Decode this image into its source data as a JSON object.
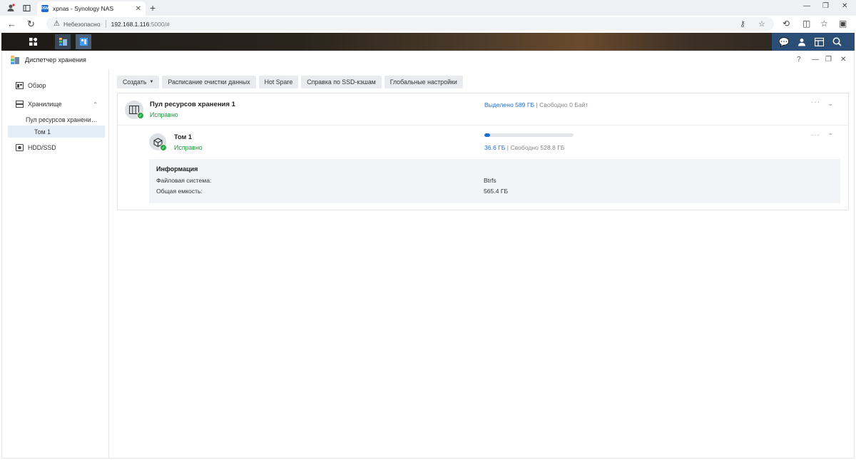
{
  "browser": {
    "tab_title": "xpnas - Synology NAS",
    "tab_favicon_text": "DSM",
    "security_label": "Небезопасно",
    "url_host": "192.168.1.116",
    "url_path": ":5000/#"
  },
  "app": {
    "title": "Диспетчер хранения",
    "help": "?"
  },
  "sidebar": {
    "overview": "Обзор",
    "storage": "Хранилище",
    "pool": "Пул ресурсов хранени…",
    "volume": "Том 1",
    "hdd": "HDD/SSD"
  },
  "toolbar": {
    "create": "Создать",
    "scrub_schedule": "Расписание очистки данных",
    "hot_spare": "Hot Spare",
    "ssd_cache": "Справка по SSD-кэшам",
    "global_settings": "Глобальные настройки"
  },
  "pool": {
    "name": "Пул ресурсов хранения 1",
    "status": "Исправно",
    "allocated": "Выделено 589 ГБ",
    "sep": " | ",
    "free": "Свободно 0 Байт"
  },
  "volume": {
    "name": "Том 1",
    "status": "Исправно",
    "used_fraction": 0.065,
    "used": "36.6 ГБ",
    "sep": " | ",
    "free": "Свободно 528.8 ГБ"
  },
  "info": {
    "title": "Информация",
    "fs_label": "Файловая система:",
    "fs_value": "Btrfs",
    "capacity_label": "Общая емкость:",
    "capacity_value": "565.4 ГБ"
  },
  "colors": {
    "accent": "#1f6fce",
    "ok": "#1a9a3a",
    "active_bg": "#e3eef9"
  }
}
